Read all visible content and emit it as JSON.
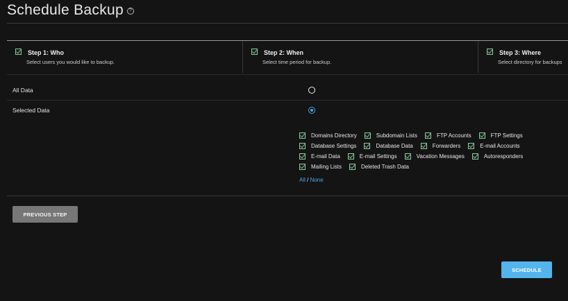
{
  "page": {
    "title": "Schedule Backup",
    "help_icon": "question-circle-icon"
  },
  "steps": [
    {
      "title": "Step 1: Who",
      "subtitle": "Select users you would like to backup.",
      "checked": true
    },
    {
      "title": "Step 2: When",
      "subtitle": "Select time period for backup.",
      "checked": true
    },
    {
      "title": "Step 3: Where",
      "subtitle": "Select directory for backups",
      "checked": true
    }
  ],
  "data_choice": {
    "all_label": "All Data",
    "selected_label": "Selected Data",
    "selected": "Selected Data"
  },
  "options": [
    [
      "Domains Directory",
      "Subdomain Lists",
      "FTP Accounts",
      "FTP Settings"
    ],
    [
      "Database Settings",
      "Database Data",
      "Forwarders",
      "E-mail Accounts"
    ],
    [
      "E-mail Data",
      "E-mail Settings",
      "Vacation Messages",
      "Autoresponders"
    ],
    [
      "Mailing Lists",
      "Deleted Trash Data"
    ]
  ],
  "select_links": {
    "all": "All",
    "separator": " / ",
    "none": "None"
  },
  "buttons": {
    "previous": "PREVIOUS STEP",
    "schedule": "SCHEDULE"
  },
  "colors": {
    "background": "#141414",
    "accent": "#4aa8e8",
    "check": "#68c48b",
    "schedule_button": "#54b4ec",
    "previous_button": "#777777"
  }
}
